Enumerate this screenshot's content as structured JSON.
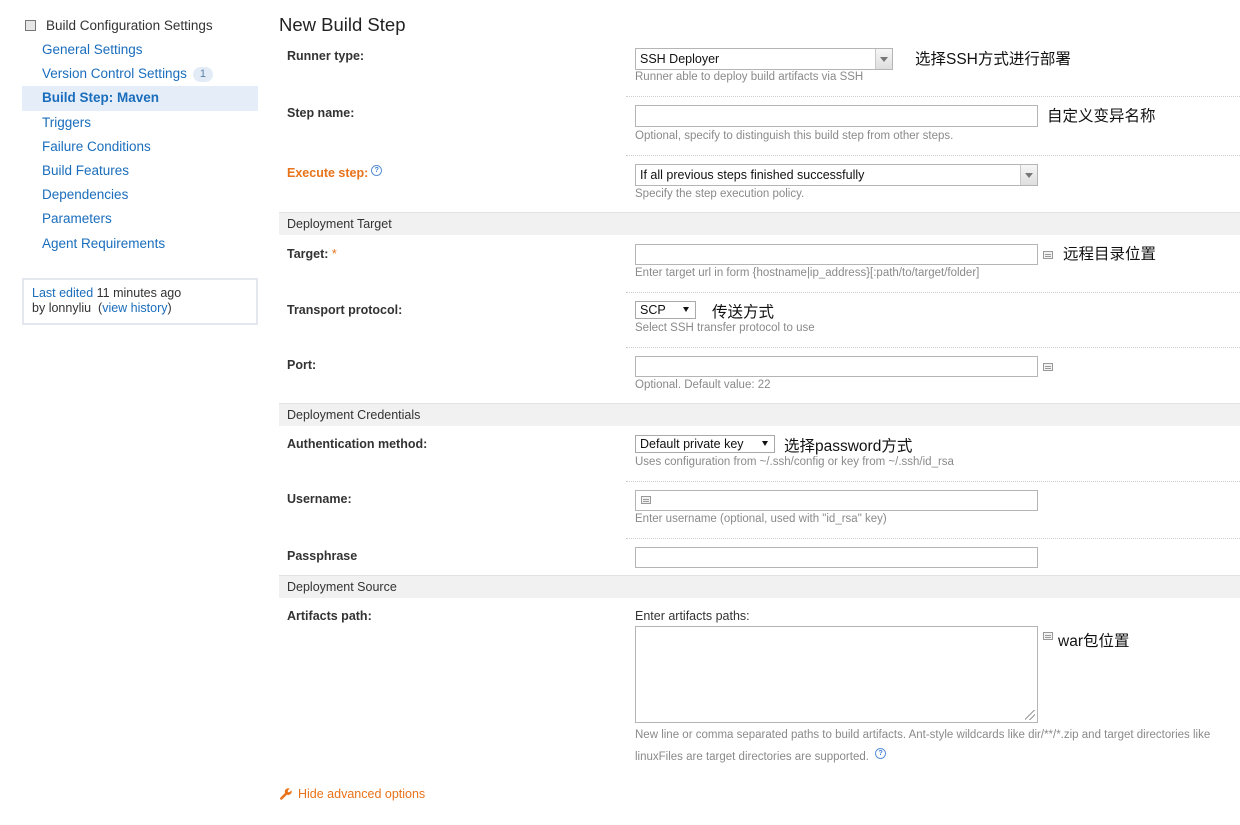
{
  "sidebar": {
    "header": "Build Configuration Settings",
    "items": [
      {
        "label": "General Settings"
      },
      {
        "label": "Version Control Settings",
        "badge": "1"
      },
      {
        "label": "Build Step: Maven"
      },
      {
        "label": "Triggers"
      },
      {
        "label": "Failure Conditions"
      },
      {
        "label": "Build Features"
      },
      {
        "label": "Dependencies"
      },
      {
        "label": "Parameters"
      },
      {
        "label": "Agent Requirements"
      }
    ],
    "last_edited_prefix": "Last edited",
    "last_edited_time": "11 minutes ago",
    "by_prefix": "by",
    "user": "lonnyliu",
    "view_history": "view history"
  },
  "main": {
    "title": "New Build Step",
    "runner_type": {
      "label": "Runner type:",
      "value": "SSH Deployer",
      "note": "Runner able to deploy build artifacts via SSH",
      "annotation": "选择SSH方式进行部署"
    },
    "step_name": {
      "label": "Step name:",
      "value": "",
      "note": "Optional, specify to distinguish this build step from other steps.",
      "annotation": "自定义变异名称"
    },
    "execute_step": {
      "label": "Execute step:",
      "help": "?",
      "value": "If all previous steps finished successfully",
      "note": "Specify the step execution policy."
    },
    "section_target": "Deployment Target",
    "target": {
      "label": "Target:",
      "required": "*",
      "value": "",
      "note": "Enter target url in form {hostname|ip_address}[:path/to/target/folder]",
      "annotation": "远程目录位置"
    },
    "transport": {
      "label": "Transport protocol:",
      "value": "SCP",
      "note": "Select SSH transfer protocol to use",
      "annotation": "传送方式"
    },
    "port": {
      "label": "Port:",
      "value": "",
      "note": "Optional. Default value: 22"
    },
    "section_credentials": "Deployment Credentials",
    "auth": {
      "label": "Authentication method:",
      "value": "Default private key",
      "note": "Uses configuration from ~/.ssh/config or key from ~/.ssh/id_rsa",
      "annotation": "选择password方式"
    },
    "username": {
      "label": "Username:",
      "value": "",
      "note": "Enter username (optional, used with \"id_rsa\" key)"
    },
    "passphrase": {
      "label": "Passphrase",
      "value": ""
    },
    "section_source": "Deployment Source",
    "artifacts": {
      "label": "Artifacts path:",
      "caption": "Enter artifacts paths:",
      "value": "",
      "annotation": "war包位置",
      "note_line1": "New line or comma separated paths to build artifacts. Ant-style wildcards like dir/**/*.zip and target directories like",
      "note_line2": "linuxFiles are target directories are supported."
    },
    "hide_advanced": "Hide advanced options"
  },
  "colors": {
    "link": "#1a6dbc",
    "accent_orange": "#e8731a",
    "selected_bg": "#e5eef8",
    "section_bg": "#f1f1f1"
  }
}
